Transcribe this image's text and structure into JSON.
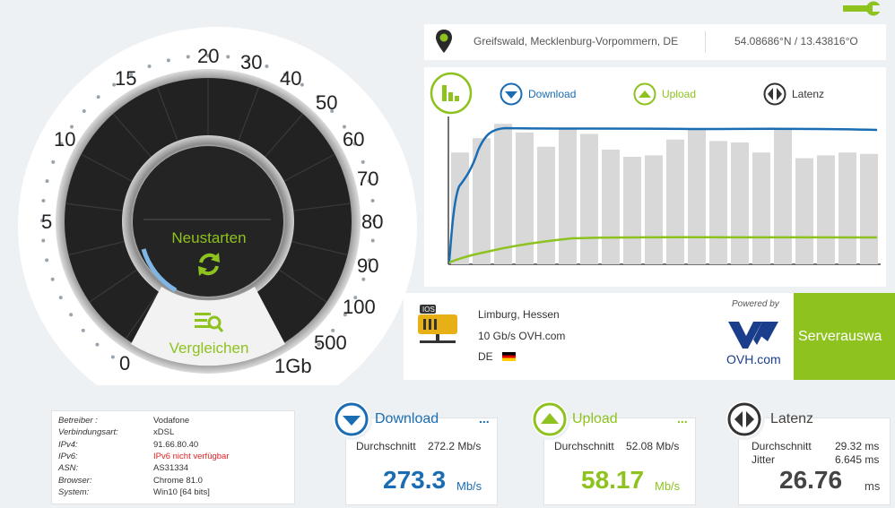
{
  "location": {
    "city": "Greifswald, Mecklenburg-Vorpommern, DE",
    "coords": "54.08686°N / 13.43816°O"
  },
  "gauge": {
    "ticks": [
      "0",
      "5",
      "10",
      "15",
      "20",
      "30",
      "40",
      "50",
      "60",
      "70",
      "80",
      "90",
      "100",
      "500",
      "1Gb"
    ],
    "restart_label": "Neustarten",
    "compare_label": "Vergleichen"
  },
  "graph": {
    "legend_download": "Download",
    "legend_upload": "Upload",
    "legend_latency": "Latenz",
    "bars": [
      0.78,
      0.88,
      0.98,
      0.92,
      0.82,
      0.95,
      0.91,
      0.8,
      0.75,
      0.76,
      0.87,
      0.94,
      0.86,
      0.85,
      0.78,
      0.95,
      0.74,
      0.76,
      0.78,
      0.77
    ]
  },
  "server": {
    "city": "Limburg, Hessen",
    "provider": "10 Gb/s OVH.com",
    "country": "DE",
    "powered_by": "Powered by",
    "ovh_brand": "OVH.com",
    "select_button": "Serverauswa"
  },
  "info": [
    {
      "key": "Betreiber :",
      "value": "Vodafone"
    },
    {
      "key": "Verbindungsart:",
      "value": "xDSL"
    },
    {
      "key": "IPv4:",
      "value": "91.66.80.40"
    },
    {
      "key": "IPv6:",
      "value": "IPv6 nicht verfügbar",
      "warn": true
    },
    {
      "key": "ASN:",
      "value": "AS31334"
    },
    {
      "key": "Browser:",
      "value": "Chrome 81.0"
    },
    {
      "key": "System:",
      "value": "Win10 [64 bits]"
    }
  ],
  "download": {
    "title": "Download",
    "avg_label": "Durchschnitt",
    "avg_value": "272.2 Mb/s",
    "value": "273.3",
    "unit": "Mb/s",
    "more": "..."
  },
  "upload": {
    "title": "Upload",
    "avg_label": "Durchschnitt",
    "avg_value": "52.08 Mb/s",
    "value": "58.17",
    "unit": "Mb/s",
    "more": "..."
  },
  "latency": {
    "title": "Latenz",
    "avg_label": "Durchschnitt",
    "avg_value": "29.32 ms",
    "jitter_label": "Jitter",
    "jitter_value": "6.645 ms",
    "value": "26.76",
    "unit": "ms"
  },
  "colors": {
    "blue": "#1a6db3",
    "green": "#8ec21f",
    "dark": "#2a2a2a"
  }
}
